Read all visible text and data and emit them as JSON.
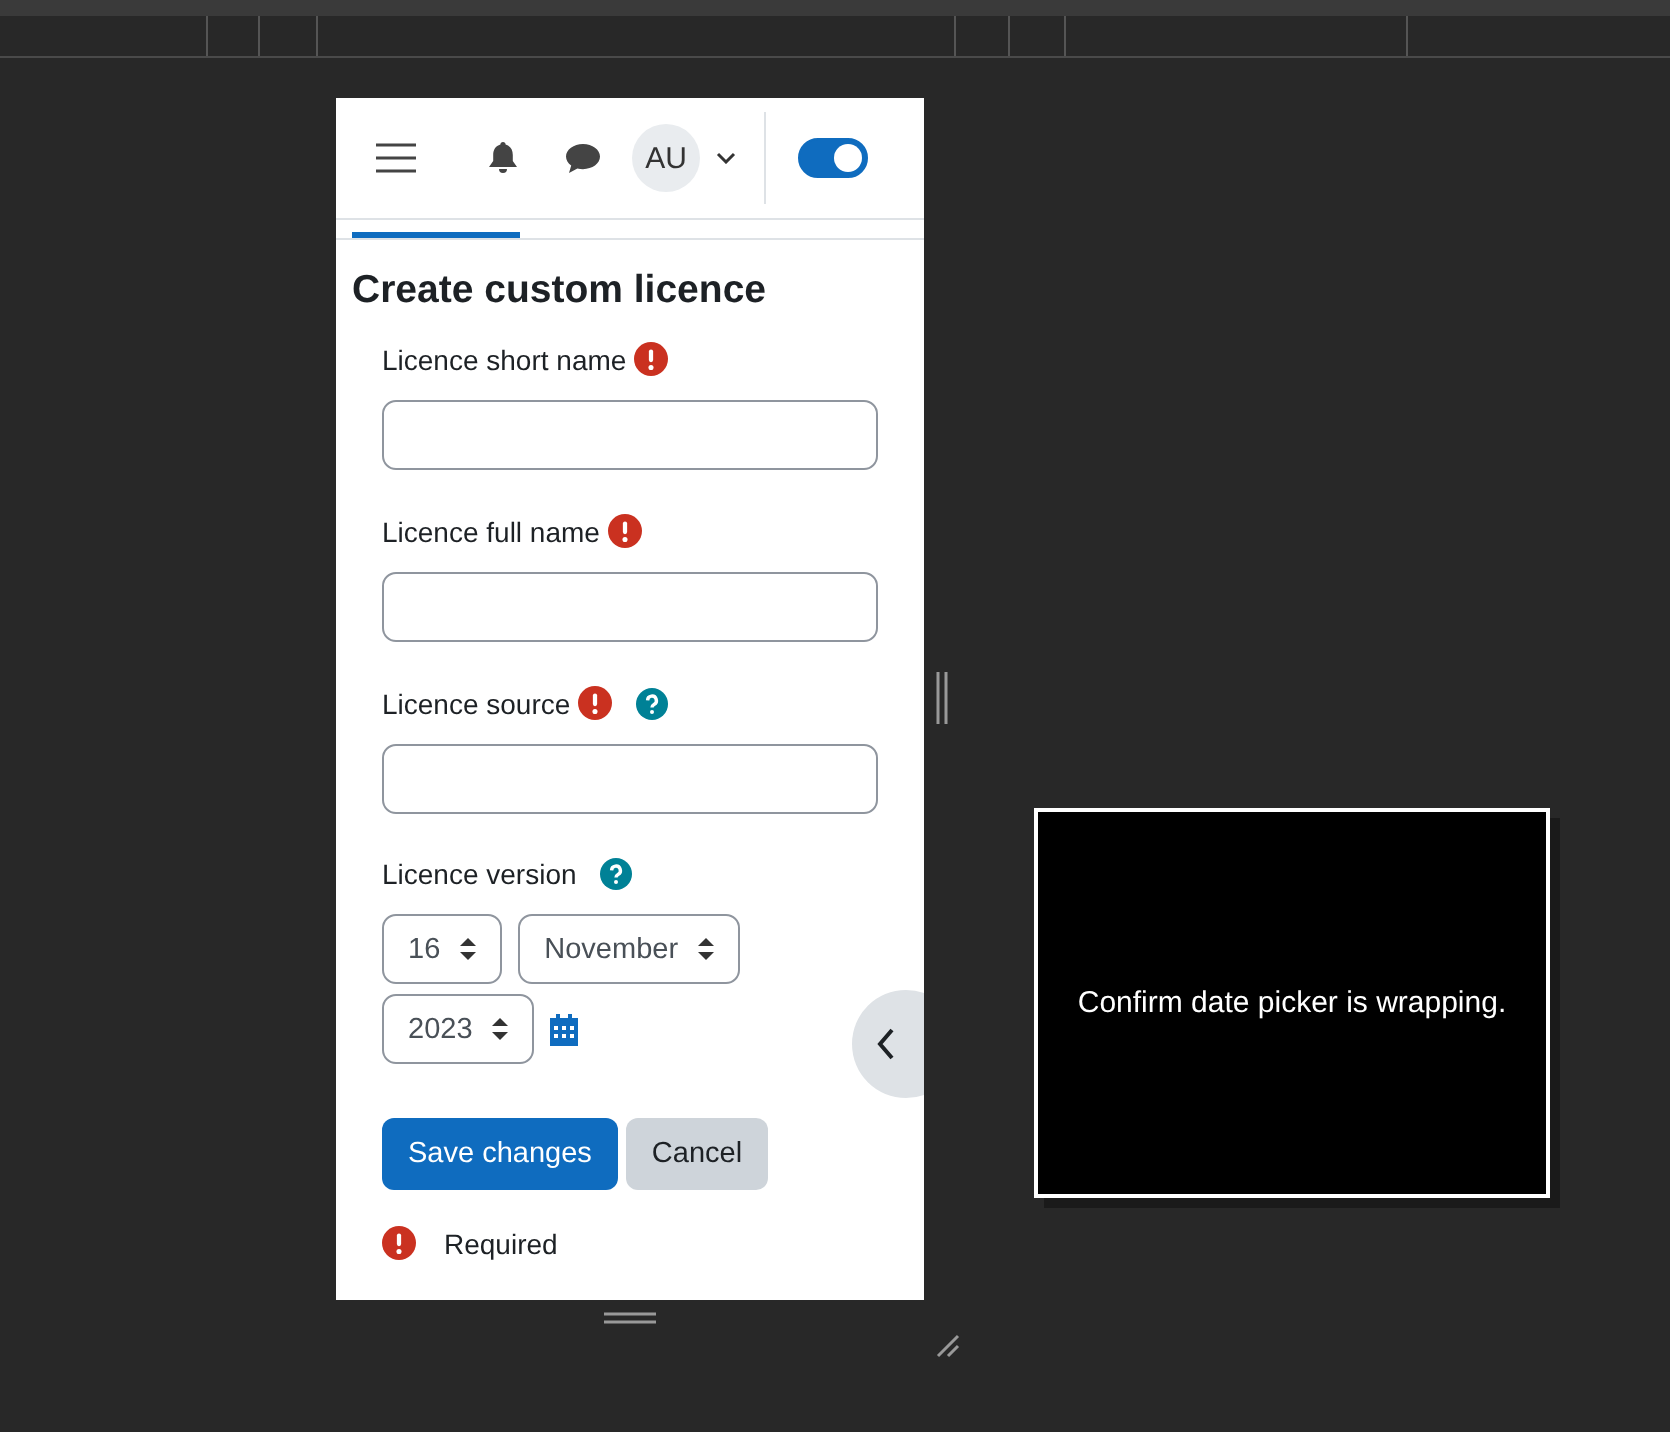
{
  "header": {
    "avatar": "AU",
    "edit_mode": {
      "on": true
    }
  },
  "form": {
    "title": "Create custom licence",
    "fields": [
      {
        "label": "Licence short name",
        "required": true,
        "help": false
      },
      {
        "label": "Licence full name",
        "required": true,
        "help": false
      },
      {
        "label": "Licence source",
        "required": true,
        "help": true
      }
    ],
    "date_field": {
      "label": "Licence version",
      "required": false,
      "help": true,
      "day": "16",
      "month": "November",
      "year": "2023"
    },
    "buttons": [
      {
        "label": "Save changes",
        "kind": "primary"
      },
      {
        "label": "Cancel",
        "kind": "secondary"
      }
    ],
    "legend": "Required"
  },
  "note": "Confirm date picker is wrapping."
}
